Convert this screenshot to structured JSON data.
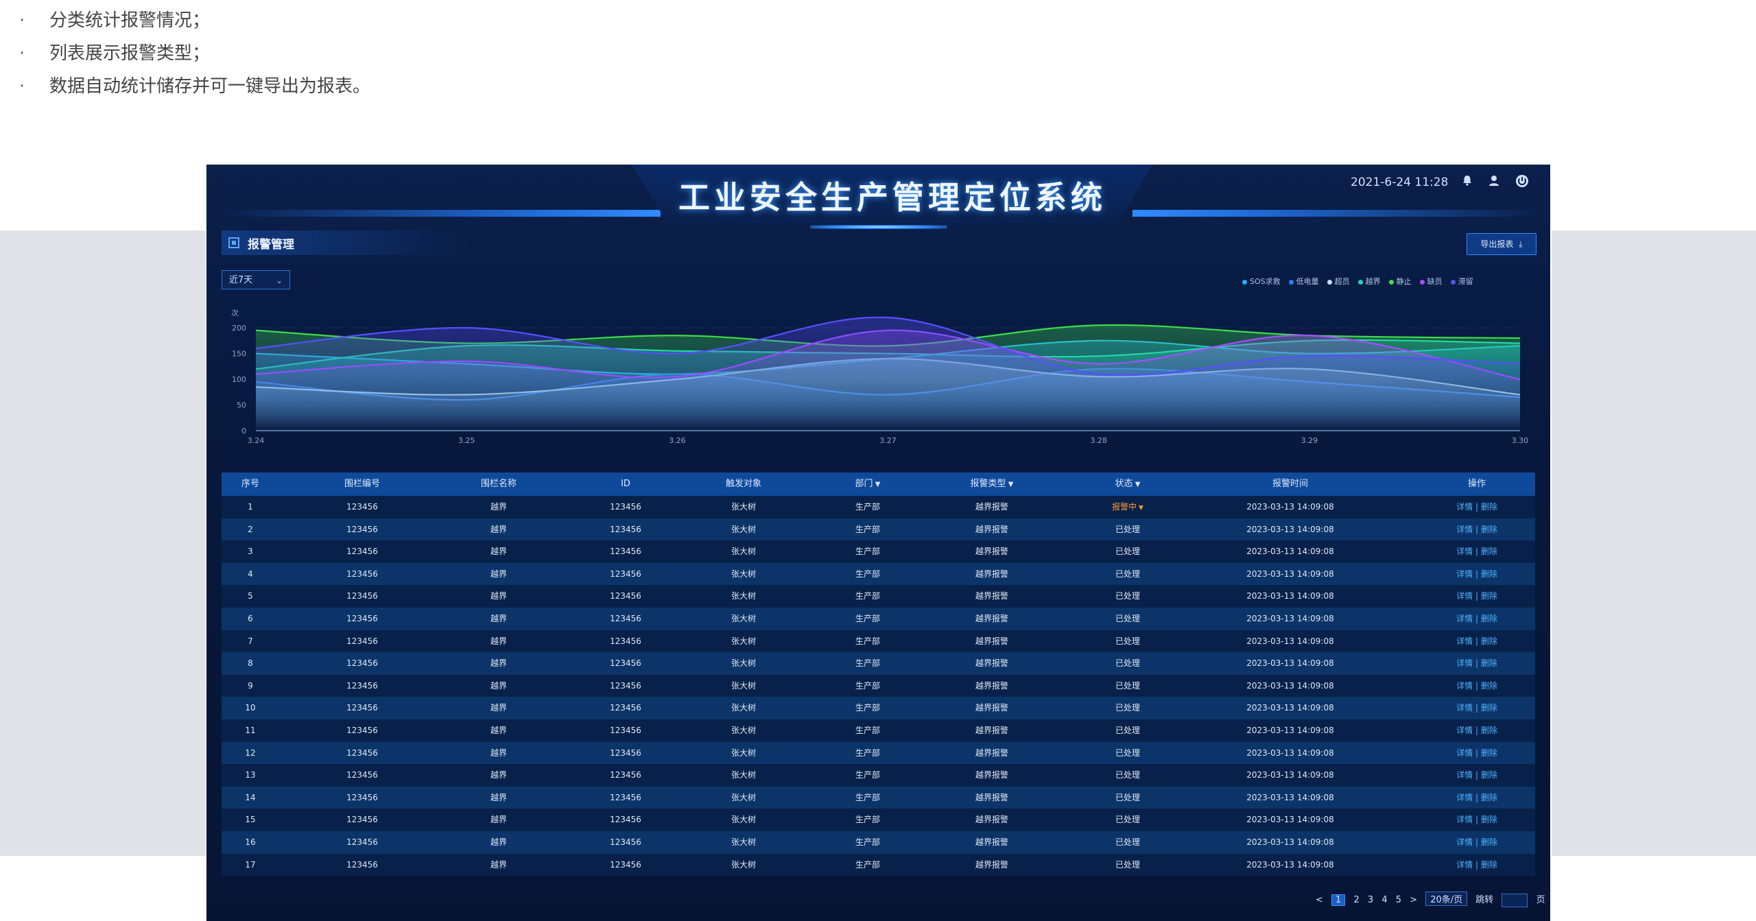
{
  "bullets": [
    "分类统计报警情况；",
    "列表展示报警类型；",
    "数据自动统计储存并可一键导出为报表。"
  ],
  "header": {
    "title": "工业安全生产管理定位系统",
    "datetime": "2021-6-24 11:28"
  },
  "section": {
    "title": "报警管理"
  },
  "toolbar": {
    "export_label": "导出报表"
  },
  "range_select": {
    "value": "近7天"
  },
  "colors": {
    "accent": "#2f8cff",
    "warn": "#ff9a2e",
    "panel_bg": "#08183c"
  },
  "chart_data": {
    "type": "line",
    "ylabel": "次",
    "ylim": [
      0,
      200
    ],
    "yticks": [
      "0",
      "50",
      "100",
      "150",
      "200"
    ],
    "x": [
      "3.24",
      "3.25",
      "3.26",
      "3.27",
      "3.28",
      "3.29",
      "3.30"
    ],
    "series": [
      {
        "name": "SOS求救",
        "color": "#1fb3ff",
        "values": [
          150,
          130,
          110,
          140,
          175,
          150,
          165
        ]
      },
      {
        "name": "低电量",
        "color": "#2f7dff",
        "values": [
          95,
          60,
          110,
          70,
          120,
          95,
          65
        ]
      },
      {
        "name": "超员",
        "color": "#bfe3ff",
        "values": [
          85,
          70,
          100,
          140,
          105,
          120,
          70
        ]
      },
      {
        "name": "越界",
        "color": "#18d4c8",
        "values": [
          120,
          165,
          155,
          150,
          145,
          175,
          170
        ]
      },
      {
        "name": "静止",
        "color": "#3ddc4a",
        "values": [
          195,
          170,
          185,
          165,
          205,
          185,
          180
        ]
      },
      {
        "name": "缺员",
        "color": "#a44dff",
        "values": [
          110,
          135,
          105,
          195,
          130,
          185,
          100
        ]
      },
      {
        "name": "滞留",
        "color": "#5a4dff",
        "values": [
          160,
          200,
          150,
          220,
          110,
          145,
          130
        ]
      }
    ]
  },
  "table": {
    "columns": [
      "序号",
      "围栏编号",
      "围栏名称",
      "ID",
      "触发对象",
      "部门",
      "报警类型",
      "状态",
      "报警时间",
      "操作"
    ],
    "sortable": [
      false,
      false,
      false,
      false,
      false,
      true,
      true,
      true,
      false,
      false
    ],
    "rows": [
      [
        "1",
        "123456",
        "越界",
        "123456",
        "张大树",
        "生产部",
        "越界报警",
        "报警中",
        "2023-03-13 14:09:08",
        "详情 | 删除"
      ],
      [
        "2",
        "123456",
        "越界",
        "123456",
        "张大树",
        "生产部",
        "越界报警",
        "已处理",
        "2023-03-13 14:09:08",
        "详情 | 删除"
      ],
      [
        "3",
        "123456",
        "越界",
        "123456",
        "张大树",
        "生产部",
        "越界报警",
        "已处理",
        "2023-03-13 14:09:08",
        "详情 | 删除"
      ],
      [
        "4",
        "123456",
        "越界",
        "123456",
        "张大树",
        "生产部",
        "越界报警",
        "已处理",
        "2023-03-13 14:09:08",
        "详情 | 删除"
      ],
      [
        "5",
        "123456",
        "越界",
        "123456",
        "张大树",
        "生产部",
        "越界报警",
        "已处理",
        "2023-03-13 14:09:08",
        "详情 | 删除"
      ],
      [
        "6",
        "123456",
        "越界",
        "123456",
        "张大树",
        "生产部",
        "越界报警",
        "已处理",
        "2023-03-13 14:09:08",
        "详情 | 删除"
      ],
      [
        "7",
        "123456",
        "越界",
        "123456",
        "张大树",
        "生产部",
        "越界报警",
        "已处理",
        "2023-03-13 14:09:08",
        "详情 | 删除"
      ],
      [
        "8",
        "123456",
        "越界",
        "123456",
        "张大树",
        "生产部",
        "越界报警",
        "已处理",
        "2023-03-13 14:09:08",
        "详情 | 删除"
      ],
      [
        "9",
        "123456",
        "越界",
        "123456",
        "张大树",
        "生产部",
        "越界报警",
        "已处理",
        "2023-03-13 14:09:08",
        "详情 | 删除"
      ],
      [
        "10",
        "123456",
        "越界",
        "123456",
        "张大树",
        "生产部",
        "越界报警",
        "已处理",
        "2023-03-13 14:09:08",
        "详情 | 删除"
      ],
      [
        "11",
        "123456",
        "越界",
        "123456",
        "张大树",
        "生产部",
        "越界报警",
        "已处理",
        "2023-03-13 14:09:08",
        "详情 | 删除"
      ],
      [
        "12",
        "123456",
        "越界",
        "123456",
        "张大树",
        "生产部",
        "越界报警",
        "已处理",
        "2023-03-13 14:09:08",
        "详情 | 删除"
      ],
      [
        "13",
        "123456",
        "越界",
        "123456",
        "张大树",
        "生产部",
        "越界报警",
        "已处理",
        "2023-03-13 14:09:08",
        "详情 | 删除"
      ],
      [
        "14",
        "123456",
        "越界",
        "123456",
        "张大树",
        "生产部",
        "越界报警",
        "已处理",
        "2023-03-13 14:09:08",
        "详情 | 删除"
      ],
      [
        "15",
        "123456",
        "越界",
        "123456",
        "张大树",
        "生产部",
        "越界报警",
        "已处理",
        "2023-03-13 14:09:08",
        "详情 | 删除"
      ],
      [
        "16",
        "123456",
        "越界",
        "123456",
        "张大树",
        "生产部",
        "越界报警",
        "已处理",
        "2023-03-13 14:09:08",
        "详情 | 删除"
      ],
      [
        "17",
        "123456",
        "越界",
        "123456",
        "张大树",
        "生产部",
        "越界报警",
        "已处理",
        "2023-03-13 14:09:08",
        "详情 | 删除"
      ]
    ]
  },
  "pagination": {
    "prev": "<",
    "pages": [
      "1",
      "2",
      "3",
      "4",
      "5"
    ],
    "current": "1",
    "next": ">",
    "page_size": "20条/页",
    "jump_label": "跳转",
    "page_suffix": "页"
  },
  "icons": {
    "bell": "bell-icon",
    "user": "user-icon",
    "power": "power-icon",
    "export": "download-icon",
    "dropdown": "chevron-down-icon"
  }
}
